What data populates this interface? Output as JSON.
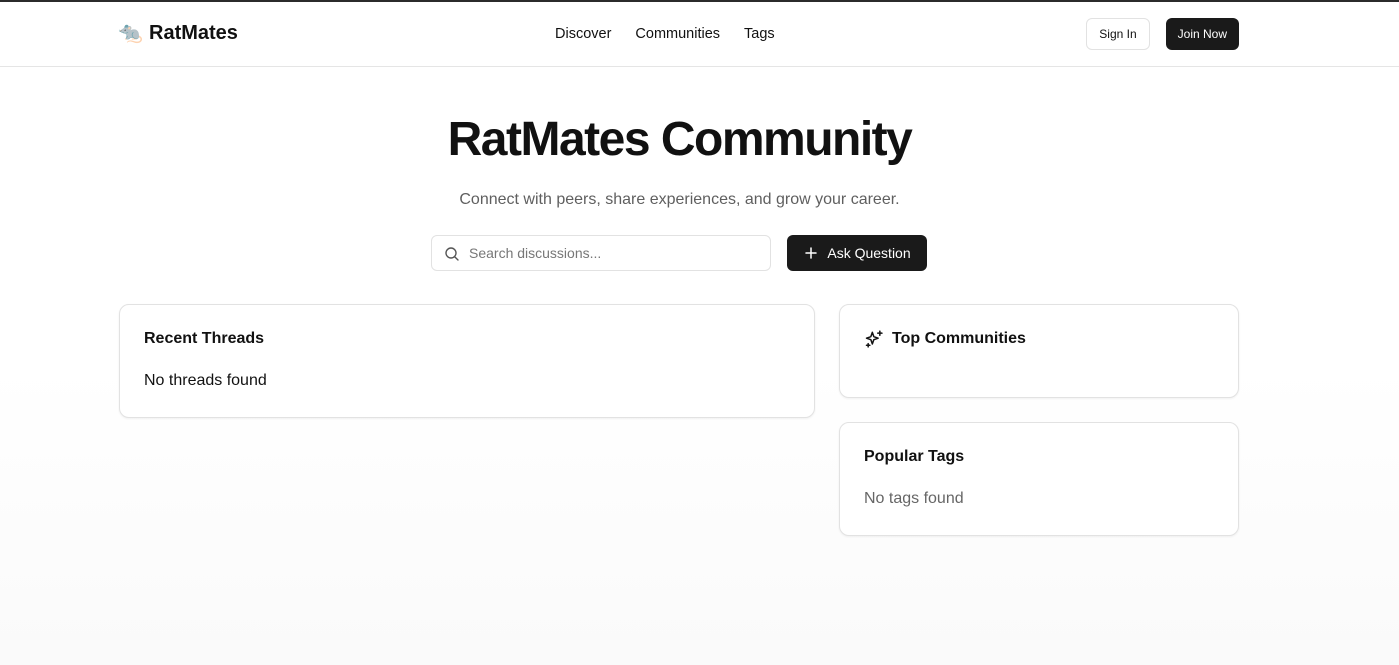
{
  "header": {
    "brand_icon": "🐀",
    "brand_name": "RatMates",
    "nav": [
      {
        "label": "Discover"
      },
      {
        "label": "Communities"
      },
      {
        "label": "Tags"
      }
    ],
    "sign_in_label": "Sign In",
    "join_label": "Join Now"
  },
  "hero": {
    "title": "RatMates Community",
    "subtitle": "Connect with peers, share experiences, and grow your career.",
    "search_placeholder": "Search discussions...",
    "search_value": "",
    "ask_label": "Ask Question"
  },
  "threads": {
    "title": "Recent Threads",
    "empty_text": "No threads found"
  },
  "communities": {
    "title": "Top Communities",
    "icon": "sparkles-icon"
  },
  "tags": {
    "title": "Popular Tags",
    "empty_text": "No tags found"
  },
  "colors": {
    "primary": "#1a1a1a",
    "border": "#e2e2e2",
    "muted_text": "#666666"
  }
}
